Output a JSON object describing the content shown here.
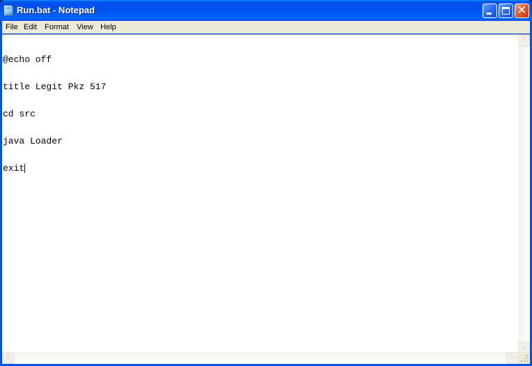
{
  "window": {
    "title": "Run.bat - Notepad",
    "app_icon": "notepad-icon",
    "controls": {
      "minimize": "minimize-icon",
      "maximize": "maximize-icon",
      "close": "close-icon",
      "close_glyph": "✕"
    }
  },
  "menubar": {
    "items": [
      {
        "label": "File"
      },
      {
        "label": "Edit"
      },
      {
        "label": "Format"
      },
      {
        "label": "View"
      },
      {
        "label": "Help"
      }
    ]
  },
  "editor": {
    "lines": [
      "@echo off",
      "title Legit Pkz 517",
      "cd src",
      "java Loader",
      "exit"
    ]
  },
  "scrollbars": {
    "up_glyph": "⌃",
    "down_glyph": "⌄",
    "left_glyph": "‹",
    "right_glyph": "›"
  }
}
